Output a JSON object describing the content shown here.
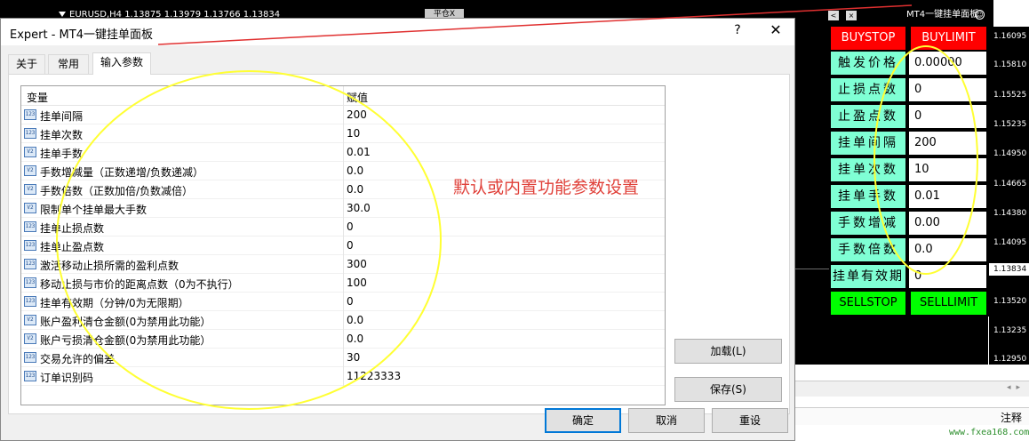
{
  "chart": {
    "title": "EURUSD,H4  1.13875 1.13979 1.13766 1.13834",
    "close_order_label": "平仓X",
    "mini_buttons": [
      "<",
      "×"
    ],
    "panel_label": "MT4一键挂单面板",
    "price_ticks": [
      "1.16095",
      "1.15810",
      "1.15525",
      "1.15235",
      "1.14950",
      "1.14665",
      "1.14380",
      "1.14095",
      "1.13834",
      "1.13520",
      "1.13235",
      "1.12950"
    ],
    "current_price": "1.13834"
  },
  "panel": {
    "top_buttons": [
      "BUYSTOP",
      "BUYLIMIT"
    ],
    "rows": [
      {
        "label": "触发价格",
        "value": "0.00000"
      },
      {
        "label": "止损点数",
        "value": "0"
      },
      {
        "label": "止盈点数",
        "value": "0"
      },
      {
        "label": "挂单间隔",
        "value": "200"
      },
      {
        "label": "挂单次数",
        "value": "10"
      },
      {
        "label": "挂单手数",
        "value": "0.01"
      },
      {
        "label": "手数增减",
        "value": "0.00"
      },
      {
        "label": "手数倍数",
        "value": "0.0"
      },
      {
        "label": "挂单有效期",
        "value": "0"
      }
    ],
    "bottom_buttons": [
      "SELLSTOP",
      "SELLLIMIT"
    ]
  },
  "dialog": {
    "title": "Expert - MT4一键挂单面板",
    "help": "?",
    "close": "✕",
    "tabs": [
      "关于",
      "常用",
      "输入参数"
    ],
    "active_tab": "输入参数",
    "grid": {
      "headers": [
        "变量",
        "赋值"
      ],
      "rows": [
        {
          "icon": "123",
          "name": "挂单间隔",
          "value": "200"
        },
        {
          "icon": "123",
          "name": "挂单次数",
          "value": "10"
        },
        {
          "icon": "V2",
          "name": "挂单手数",
          "value": "0.01"
        },
        {
          "icon": "V2",
          "name": "手数增减量（正数递增/负数递减）",
          "value": "0.0"
        },
        {
          "icon": "V2",
          "name": "手数倍数（正数加倍/负数减倍）",
          "value": "0.0"
        },
        {
          "icon": "V2",
          "name": "限制单个挂单最大手数",
          "value": "30.0"
        },
        {
          "icon": "123",
          "name": "挂单止损点数",
          "value": "0"
        },
        {
          "icon": "123",
          "name": "挂单止盈点数",
          "value": "0"
        },
        {
          "icon": "123",
          "name": "激活移动止损所需的盈利点数",
          "value": "300"
        },
        {
          "icon": "123",
          "name": "移动止损与市价的距离点数（0为不执行）",
          "value": "100"
        },
        {
          "icon": "123",
          "name": "挂单有效期（分钟/0为无限期）",
          "value": "0"
        },
        {
          "icon": "V2",
          "name": "账户盈利清仓金额(0为禁用此功能）",
          "value": "0.0"
        },
        {
          "icon": "V2",
          "name": "账户亏损清仓金额(0为禁用此功能）",
          "value": "0.0"
        },
        {
          "icon": "123",
          "name": "交易允许的偏差",
          "value": "30"
        },
        {
          "icon": "123",
          "name": "订单识别码",
          "value": "11223333"
        }
      ]
    },
    "annotation": "默认或内置功能参数设置",
    "load_button": "加载(L)",
    "save_button": "保存(S)",
    "ok_button": "确定",
    "cancel_button": "取消",
    "reset_button": "重设"
  },
  "bottom": {
    "notes_label": "注释",
    "watermark": "www.fxea168.com"
  },
  "colors": {
    "panel_red": "#ff0000",
    "panel_green": "#00ff00",
    "panel_label_bg": "#7fffd4",
    "annotation": "#e0413a",
    "highlight_circle": "#ffff33",
    "arrow_line": "#e03030"
  }
}
